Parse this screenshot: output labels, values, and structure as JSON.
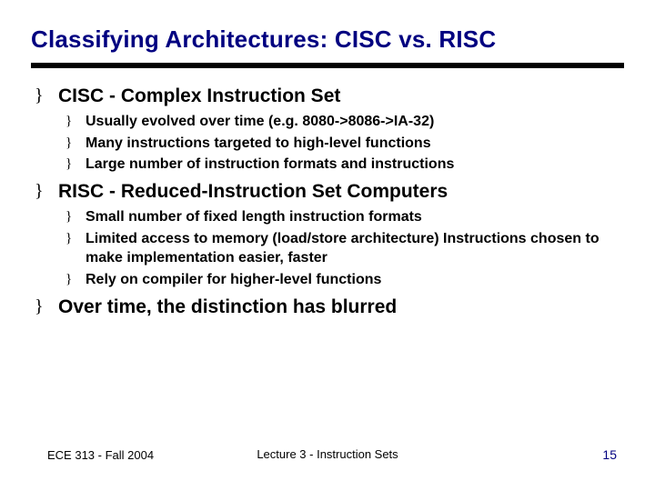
{
  "title": "Classifying Architectures: CISC vs. RISC",
  "b1": {
    "h": "CISC - Complex Instruction Set",
    "s1": "Usually evolved over time (e.g. 8080->8086->IA-32)",
    "s2": "Many instructions targeted to high-level functions",
    "s3": "Large number of instruction formats and instructions"
  },
  "b2": {
    "h": "RISC - Reduced-Instruction Set Computers",
    "s1": "Small number of fixed length instruction formats",
    "s2": "Limited access to memory (load/store architecture) Instructions chosen to make implementation easier, faster",
    "s3": "Rely on compiler for higher-level functions"
  },
  "b3": {
    "h": "Over time, the distinction has blurred"
  },
  "footer": {
    "left": "ECE 313 - Fall 2004",
    "center": "Lecture 3 - Instruction Sets",
    "right": "15"
  }
}
